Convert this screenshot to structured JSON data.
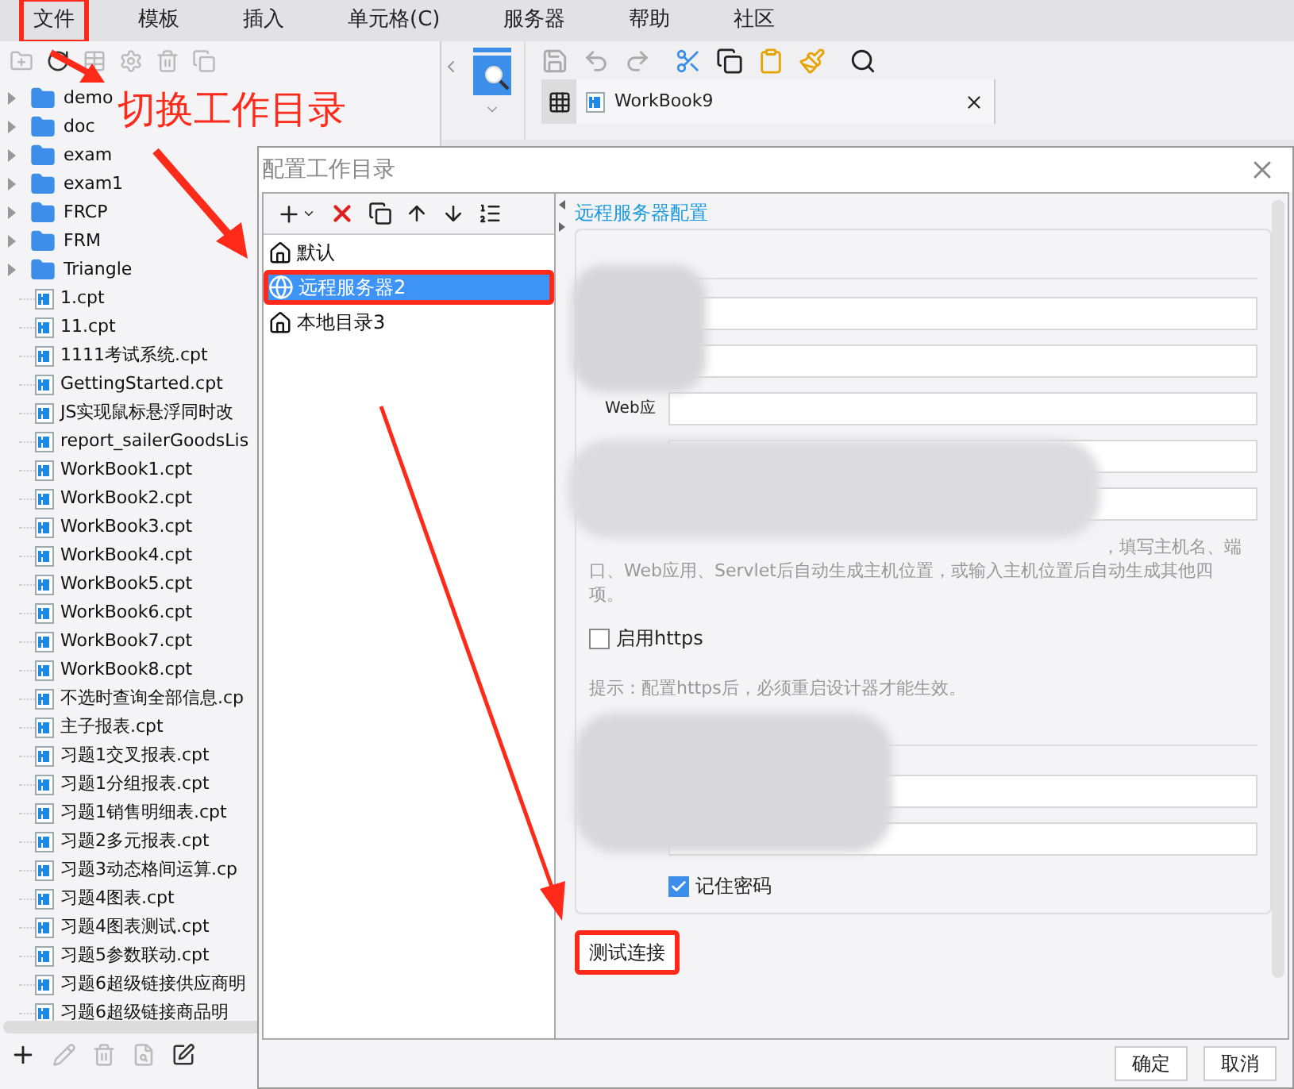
{
  "menu": [
    {
      "label": "文件",
      "highlighted": true
    },
    {
      "label": "模板",
      "highlighted": false
    },
    {
      "label": "插入",
      "highlighted": false
    },
    {
      "label": "单元格(C)",
      "highlighted": false
    },
    {
      "label": "服务器",
      "highlighted": false
    },
    {
      "label": "帮助",
      "highlighted": false
    },
    {
      "label": "社区",
      "highlighted": false
    }
  ],
  "tree": [
    {
      "name": "demo",
      "kind": "folder"
    },
    {
      "name": "doc",
      "kind": "folder"
    },
    {
      "name": "exam",
      "kind": "folder"
    },
    {
      "name": "exam1",
      "kind": "folder"
    },
    {
      "name": "FRCP",
      "kind": "folder"
    },
    {
      "name": "FRM",
      "kind": "folder"
    },
    {
      "name": "Triangle",
      "kind": "folder"
    },
    {
      "name": "1.cpt",
      "kind": "file"
    },
    {
      "name": "11.cpt",
      "kind": "file"
    },
    {
      "name": "1111考试系统.cpt",
      "kind": "file"
    },
    {
      "name": "GettingStarted.cpt",
      "kind": "file"
    },
    {
      "name": "JS实现鼠标悬浮同时改",
      "kind": "file"
    },
    {
      "name": "report_sailerGoodsLis",
      "kind": "file"
    },
    {
      "name": "WorkBook1.cpt",
      "kind": "file"
    },
    {
      "name": "WorkBook2.cpt",
      "kind": "file"
    },
    {
      "name": "WorkBook3.cpt",
      "kind": "file"
    },
    {
      "name": "WorkBook4.cpt",
      "kind": "file"
    },
    {
      "name": "WorkBook5.cpt",
      "kind": "file"
    },
    {
      "name": "WorkBook6.cpt",
      "kind": "file"
    },
    {
      "name": "WorkBook7.cpt",
      "kind": "file"
    },
    {
      "name": "WorkBook8.cpt",
      "kind": "file"
    },
    {
      "name": "不选时查询全部信息.cp",
      "kind": "file"
    },
    {
      "name": "主子报表.cpt",
      "kind": "file"
    },
    {
      "name": "习题1交叉报表.cpt",
      "kind": "file"
    },
    {
      "name": "习题1分组报表.cpt",
      "kind": "file"
    },
    {
      "name": "习题1销售明细表.cpt",
      "kind": "file"
    },
    {
      "name": "习题2多元报表.cpt",
      "kind": "file"
    },
    {
      "name": "习题3动态格间运算.cp",
      "kind": "file"
    },
    {
      "name": "习题4图表.cpt",
      "kind": "file"
    },
    {
      "name": "习题4图表测试.cpt",
      "kind": "file"
    },
    {
      "name": "习题5参数联动.cpt",
      "kind": "file"
    },
    {
      "name": "习题6超级链接供应商明",
      "kind": "file"
    },
    {
      "name": "习题6超级链接商品明",
      "kind": "file"
    }
  ],
  "main_tab": {
    "label": "WorkBook9"
  },
  "annotation": {
    "text": "切换工作目录"
  },
  "dialog": {
    "title": "配置工作目录",
    "entries": [
      {
        "name": "默认",
        "kind": "local",
        "selected": false,
        "highlighted": false
      },
      {
        "name": "远程服务器2",
        "kind": "remote",
        "selected": true,
        "highlighted": true
      },
      {
        "name": "本地目录3",
        "kind": "local",
        "selected": false,
        "highlighted": false
      }
    ],
    "group_title": "远程服务器配置",
    "web_field_label": "Web应",
    "hint_lines": [
      "，填写主机名、端",
      "口、Web应用、Servlet后自动生成主机位置，或输入主机位置后自动生成其他四",
      "项。"
    ],
    "https": {
      "label": "启用https",
      "checked": false
    },
    "https_hint": "提示：配置https后，必须重启设计器才能生效。",
    "remember": {
      "label": "记住密码",
      "checked": true
    },
    "test_button": {
      "label": "测试连接",
      "highlighted": true
    },
    "buttons": [
      "确定",
      "取消"
    ]
  }
}
